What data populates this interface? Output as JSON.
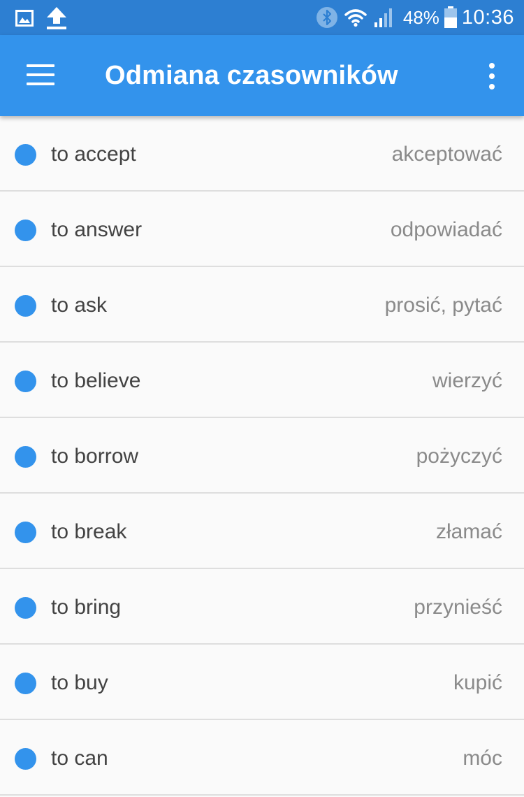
{
  "status_bar": {
    "battery": "48%",
    "time": "10:36",
    "icons": [
      "image-icon",
      "upload-icon",
      "bluetooth-icon",
      "wifi-icon",
      "signal-icon",
      "battery-icon"
    ]
  },
  "app_bar": {
    "title": "Odmiana czasowników",
    "menu_icon": "hamburger-menu-icon",
    "overflow_icon": "more-vertical-icon"
  },
  "colors": {
    "status_bar": "#2d7fd2",
    "app_bar": "#3393ec",
    "accent_dot": "#3393ec",
    "background": "#fafafa",
    "primary_text": "#424242",
    "secondary_text": "#8a8a8a"
  },
  "verbs": [
    {
      "en": "to accept",
      "pl": "akceptować"
    },
    {
      "en": "to answer",
      "pl": "odpowiadać"
    },
    {
      "en": "to ask",
      "pl": "prosić, pytać"
    },
    {
      "en": "to believe",
      "pl": "wierzyć"
    },
    {
      "en": "to borrow",
      "pl": "pożyczyć"
    },
    {
      "en": "to break",
      "pl": "złamać"
    },
    {
      "en": "to bring",
      "pl": "przynieść"
    },
    {
      "en": "to buy",
      "pl": "kupić"
    },
    {
      "en": "to can",
      "pl": "móc"
    }
  ]
}
